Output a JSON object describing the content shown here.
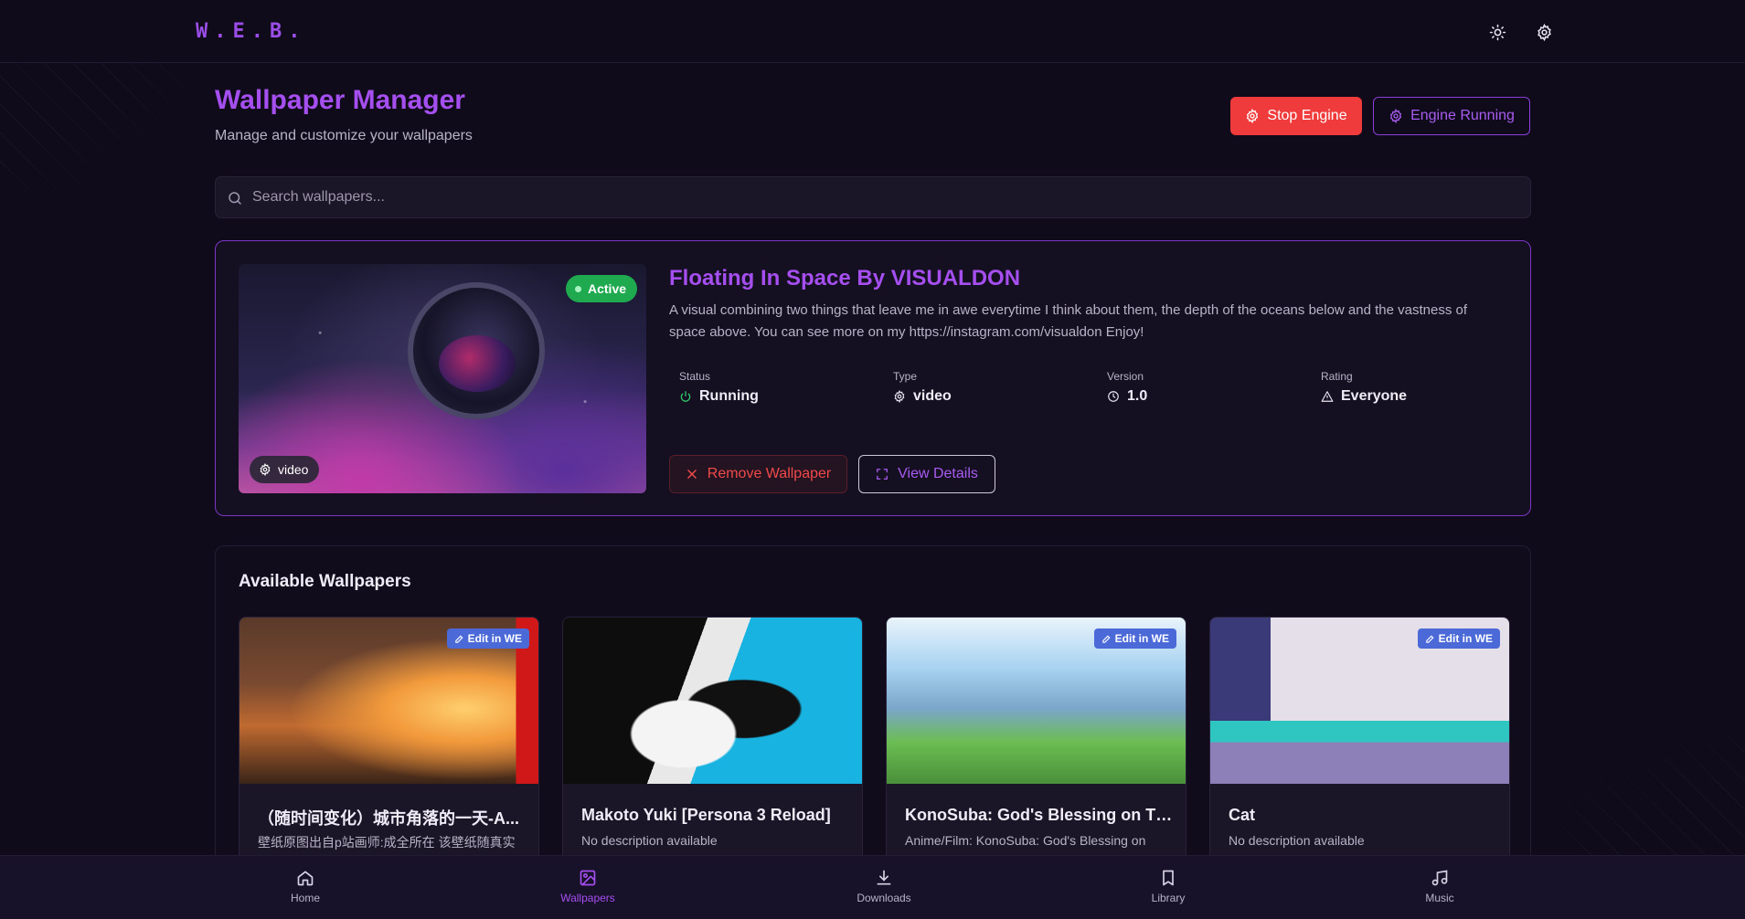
{
  "app": {
    "logo": "W.E.B."
  },
  "colors": {
    "accent": "#a64ff0",
    "danger": "#ef3b3b",
    "success": "#1faa4f",
    "edit_badge": "#4b6ad8",
    "background": "#0f0b1a"
  },
  "topbar": {
    "theme_icon": "sun-icon",
    "settings_icon": "gear-icon"
  },
  "header": {
    "title": "Wallpaper Manager",
    "subtitle": "Manage and customize your wallpapers",
    "stop_button": "Stop Engine",
    "status_button": "Engine Running"
  },
  "search": {
    "placeholder": "Search wallpapers...",
    "value": ""
  },
  "active_wallpaper": {
    "badge": "Active",
    "type_badge": "video",
    "title": "Floating In Space By VISUALDON",
    "description": "A visual combining two things that leave me in awe everytime I think about them, the depth of the oceans below and the vastness of space above. You can see more on my https://instagram.com/visualdon Enjoy!",
    "meta": [
      {
        "label": "Status",
        "value": "Running",
        "icon": "power-icon"
      },
      {
        "label": "Type",
        "value": "video",
        "icon": "gear-icon"
      },
      {
        "label": "Version",
        "value": "1.0",
        "icon": "clock-icon"
      },
      {
        "label": "Rating",
        "value": "Everyone",
        "icon": "warning-icon"
      }
    ],
    "remove_button": "Remove Wallpaper",
    "details_button": "View Details"
  },
  "available": {
    "title": "Available Wallpapers",
    "edit_label": "Edit in WE",
    "items": [
      {
        "title": "（随时间变化）城市角落的一天-A...",
        "description": "壁纸原图出自p站画师:成全所在 该壁纸随真实",
        "edit": true
      },
      {
        "title": "Makoto Yuki [Persona 3 Reload]",
        "description": "No description available",
        "edit": false
      },
      {
        "title": "KonoSuba: God's Blessing on Thi...",
        "description": "Anime/Film: KonoSuba: God's Blessing on",
        "edit": true
      },
      {
        "title": "Cat",
        "description": "No description available",
        "edit": true
      }
    ]
  },
  "nav": {
    "items": [
      {
        "label": "Home",
        "icon": "home-icon"
      },
      {
        "label": "Wallpapers",
        "icon": "image-icon",
        "active": true
      },
      {
        "label": "Downloads",
        "icon": "download-icon"
      },
      {
        "label": "Library",
        "icon": "bookmark-icon"
      },
      {
        "label": "Music",
        "icon": "music-icon"
      }
    ]
  }
}
